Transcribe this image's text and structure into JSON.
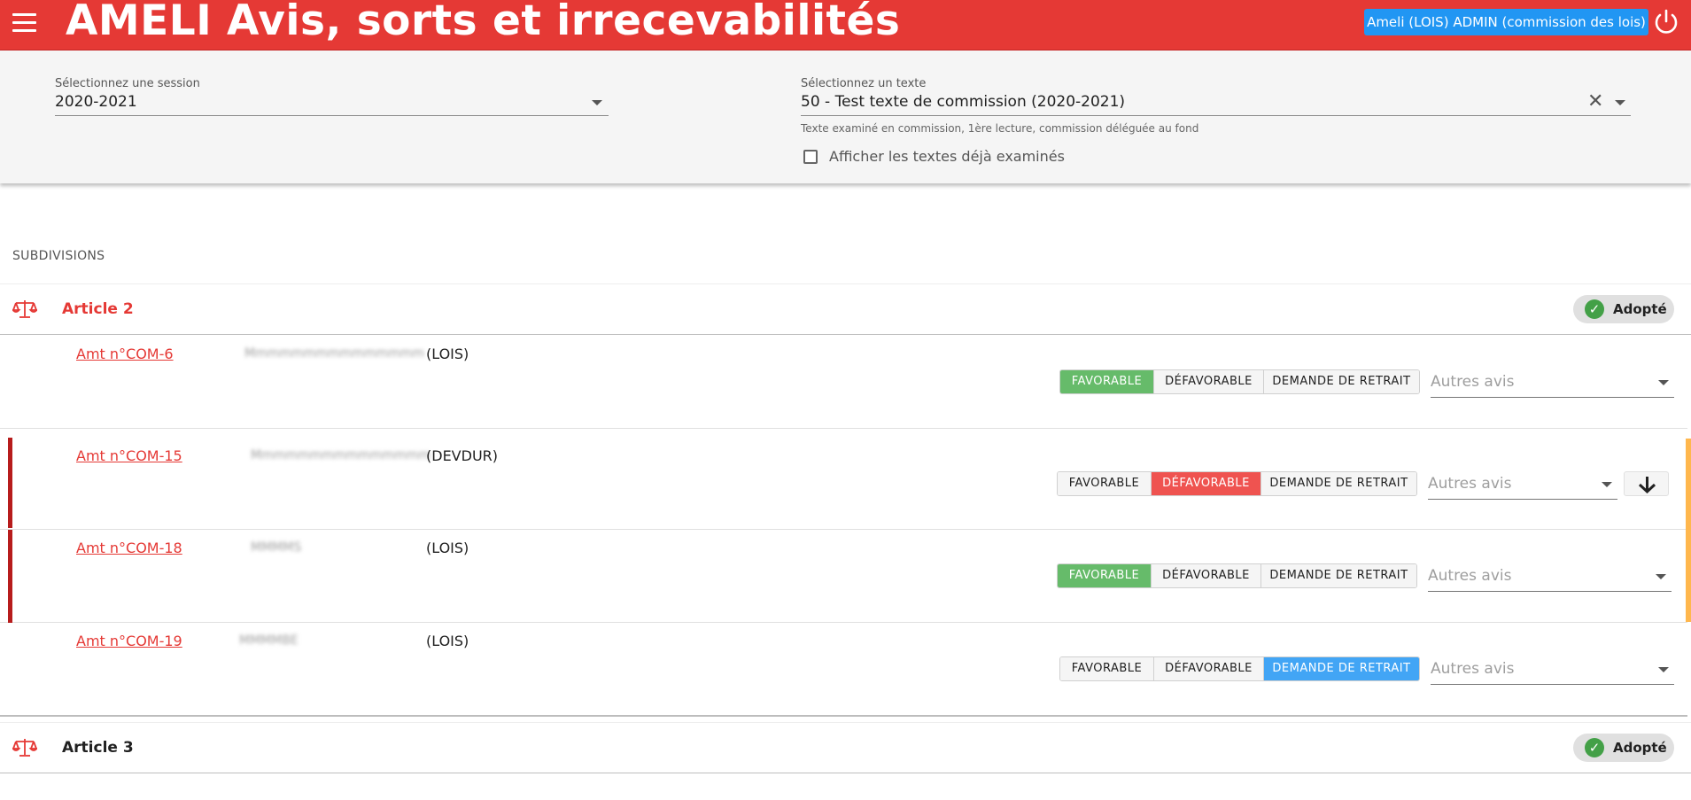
{
  "header": {
    "title": "AMELI Avis, sorts et irrecevabilités",
    "user_label": "Ameli (LOIS) ADMIN (commission des lois)"
  },
  "filters": {
    "session_label": "Sélectionnez une session",
    "session_value": "2020-2021",
    "texte_label": "Sélectionnez un texte",
    "texte_value": "50 - Test texte de commission (2020-2021)",
    "texte_hint": "Texte examiné en commission, 1ère lecture, commission déléguée au fond",
    "checkbox_label": "Afficher les textes déjà examinés",
    "checkbox_checked": false
  },
  "section_label": "SUBDIVISIONS",
  "articles": [
    {
      "title": "Article 2",
      "title_color": "#e53935",
      "status": "Adopté"
    },
    {
      "title": "Article 3",
      "title_color": "#212121",
      "status": "Adopté"
    }
  ],
  "buttons": {
    "favorable": "FAVORABLE",
    "defavorable": "DÉFAVORABLE",
    "retrait": "DEMANDE DE RETRAIT",
    "autres_placeholder": "Autres avis"
  },
  "amendements": [
    {
      "link": "Amt n°COM-6",
      "author": "Mmmmmmmmmmmmmmm",
      "commission": "(LOIS)",
      "selected": "favorable"
    },
    {
      "link": "Amt n°COM-15",
      "author": "Mmmmmmmmmmmmmmm",
      "commission": "(DEVDUR)",
      "selected": "defavorable"
    },
    {
      "link": "Amt n°COM-18",
      "author": "MMMMS",
      "commission": "(LOIS)",
      "selected": "favorable"
    },
    {
      "link": "Amt n°COM-19",
      "author": "MMMMBE",
      "commission": "(LOIS)",
      "selected": "retrait"
    }
  ],
  "icons": {
    "menu": "menu-icon",
    "power": "power-icon",
    "scale": "scale-icon",
    "check": "check-icon",
    "arrow_down": "arrow-down-icon"
  },
  "colors": {
    "appbar": "#e53935",
    "user_button": "#2196f3",
    "favorable": "#66bb6a",
    "defavorable": "#ef5350",
    "retrait": "#42a5f5"
  }
}
